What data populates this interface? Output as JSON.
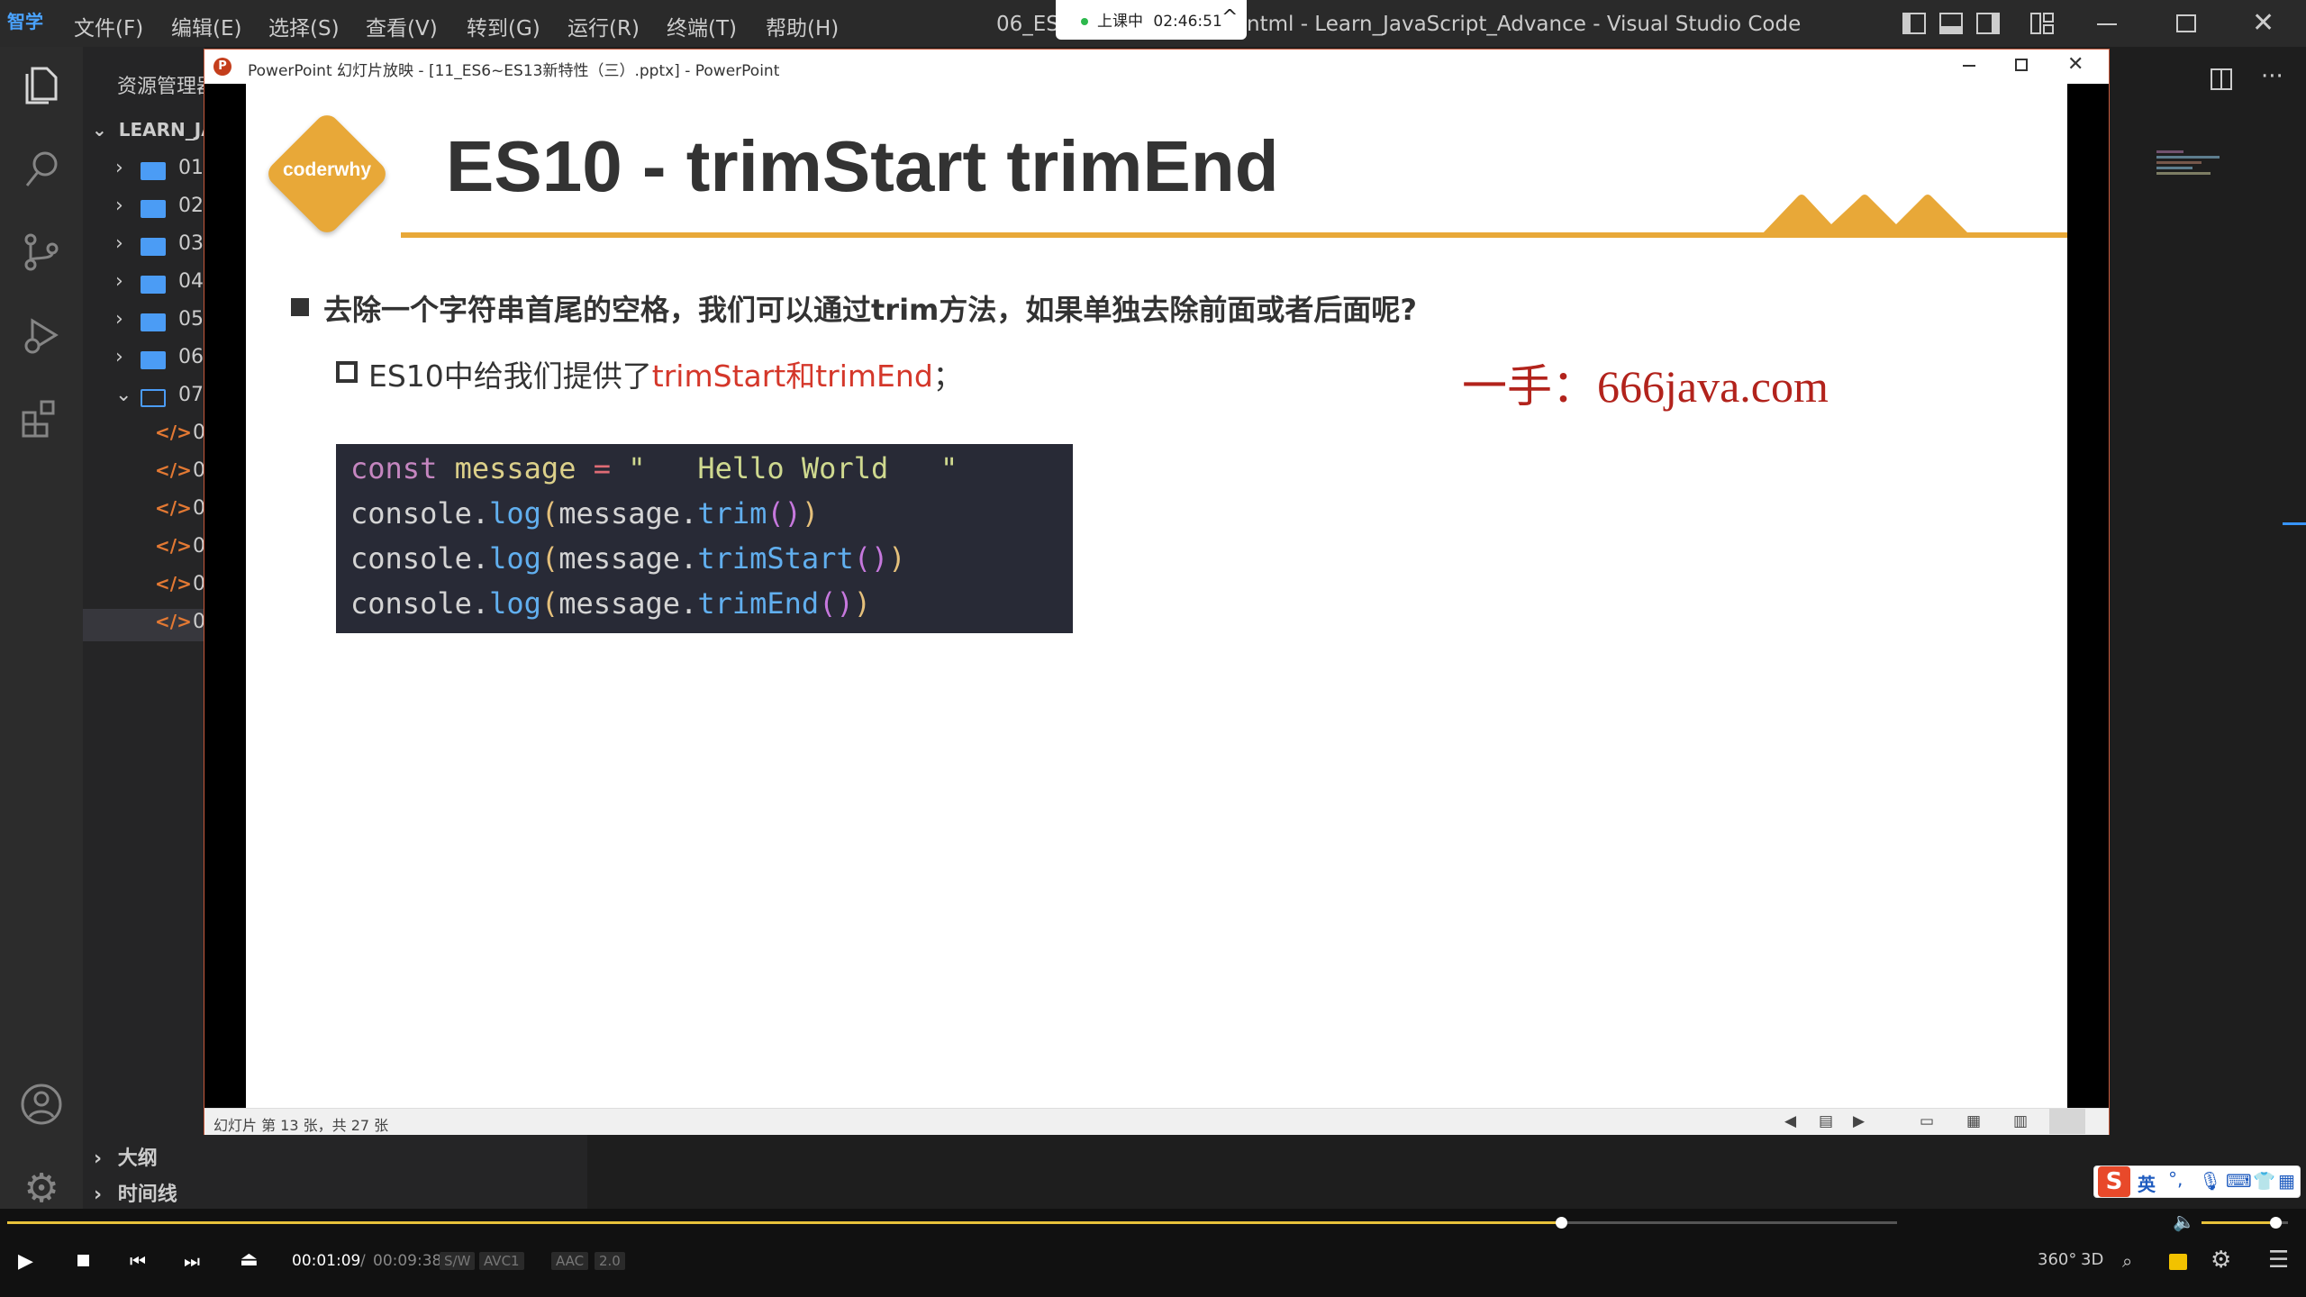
{
  "vscode": {
    "window_title": "06_ES1                    ...ntml - Learn_JavaScript_Advance - Visual Studio Code",
    "title_suffix": "ntml - Learn_JavaScript_Advance - Visual Studio Code",
    "title_prefix": "06_ES1",
    "menu": [
      "文件(F)",
      "编辑(E)",
      "选择(S)",
      "查看(V)",
      "转到(G)",
      "运行(R)",
      "终端(T)",
      "帮助(H)"
    ],
    "app_badge": "智学",
    "explorer_header": "资源管理器",
    "project_root": "LEARN_JA",
    "folders": [
      "01",
      "02",
      "03",
      "04",
      "05",
      "06",
      "07"
    ],
    "files": [
      "0",
      "0",
      "0",
      "0",
      "0",
      "0"
    ],
    "outline_label": "大纲",
    "timeline_label": "时间线"
  },
  "recording_badge": {
    "status": "上课中",
    "time": "02:46:51"
  },
  "ppt": {
    "window_title": "PowerPoint 幻灯片放映 - [11_ES6~ES13新特性（三）.pptx] - PowerPoint",
    "status_text": "幻灯片 第 13 张，共 27 张"
  },
  "slide": {
    "logo_text": "coderwhy",
    "title": "ES10 - trimStart trimEnd",
    "bullet1": "去除一个字符串首尾的空格，我们可以通过trim方法，如果单独去除前面或者后面呢?",
    "bullet2_prefix": "ES10中给我们提供了",
    "bullet2_highlight": "trimStart和trimEnd",
    "bullet2_suffix": "；",
    "watermark": "一手：666java.com",
    "code": {
      "line1": {
        "kw": "const",
        "var": "message",
        "op": "=",
        "str": "\"   Hello World   \""
      },
      "line2": {
        "obj": "console",
        "fn": "log",
        "arg": "message",
        "method": "trim"
      },
      "line3": {
        "obj": "console",
        "fn": "log",
        "arg": "message",
        "method": "trimStart"
      },
      "line4": {
        "obj": "console",
        "fn": "log",
        "arg": "message",
        "method": "trimEnd"
      }
    }
  },
  "ime": {
    "lang": "英"
  },
  "player": {
    "current_time": "00:01:09",
    "total_time": "00:09:38",
    "tags": [
      "S/W",
      "AVC1",
      "AAC",
      "2.0"
    ],
    "progress": 0.822,
    "volume": 0.85,
    "labels": [
      "360°",
      "3D"
    ]
  },
  "colors": {
    "accent_orange": "#E8A838",
    "highlight_red": "#D4372A",
    "watermark_red": "#B2231C",
    "code_bg": "#282a36"
  }
}
